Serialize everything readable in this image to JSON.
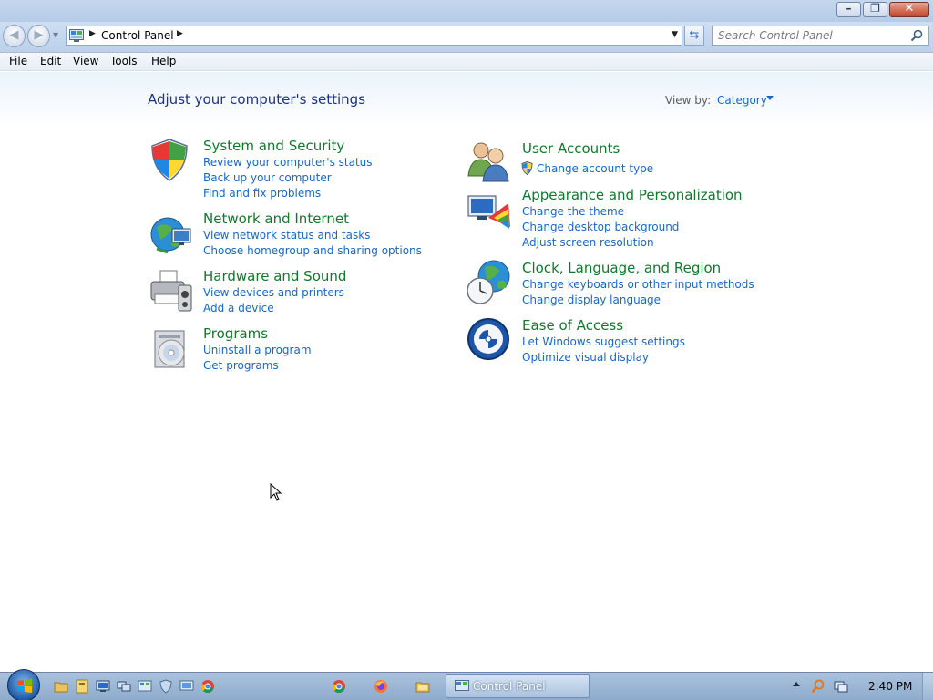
{
  "window": {
    "minimize_glyph": "–",
    "maximize_glyph": "❐",
    "close_glyph": "✕"
  },
  "nav": {
    "back_glyph": "◀",
    "forward_glyph": "▶",
    "breadcrumb": "Control Panel",
    "search_placeholder": "Search Control Panel"
  },
  "menu": {
    "file": "File",
    "edit": "Edit",
    "view": "View",
    "tools": "Tools",
    "help": "Help"
  },
  "page": {
    "title": "Adjust your computer's settings",
    "view_by_label": "View by:",
    "view_by_value": "Category"
  },
  "categories": {
    "system_security": {
      "title": "System and Security",
      "links": [
        "Review your computer's status",
        "Back up your computer",
        "Find and fix problems"
      ]
    },
    "network_internet": {
      "title": "Network and Internet",
      "links": [
        "View network status and tasks",
        "Choose homegroup and sharing options"
      ]
    },
    "hardware_sound": {
      "title": "Hardware and Sound",
      "links": [
        "View devices and printers",
        "Add a device"
      ]
    },
    "programs": {
      "title": "Programs",
      "links": [
        "Uninstall a program",
        "Get programs"
      ]
    },
    "user_accounts": {
      "title": "User Accounts",
      "links": [
        "Change account type"
      ]
    },
    "appearance": {
      "title": "Appearance and Personalization",
      "links": [
        "Change the theme",
        "Change desktop background",
        "Adjust screen resolution"
      ]
    },
    "clock_region": {
      "title": "Clock, Language, and Region",
      "links": [
        "Change keyboards or other input methods",
        "Change display language"
      ]
    },
    "ease_access": {
      "title": "Ease of Access",
      "links": [
        "Let Windows suggest settings",
        "Optimize visual display"
      ]
    }
  },
  "taskbar": {
    "active_task": "Control Panel",
    "clock": "2:40 PM"
  },
  "colors": {
    "category_title": "#0f7a2b",
    "link": "#1668c8",
    "heading": "#1e3287"
  }
}
